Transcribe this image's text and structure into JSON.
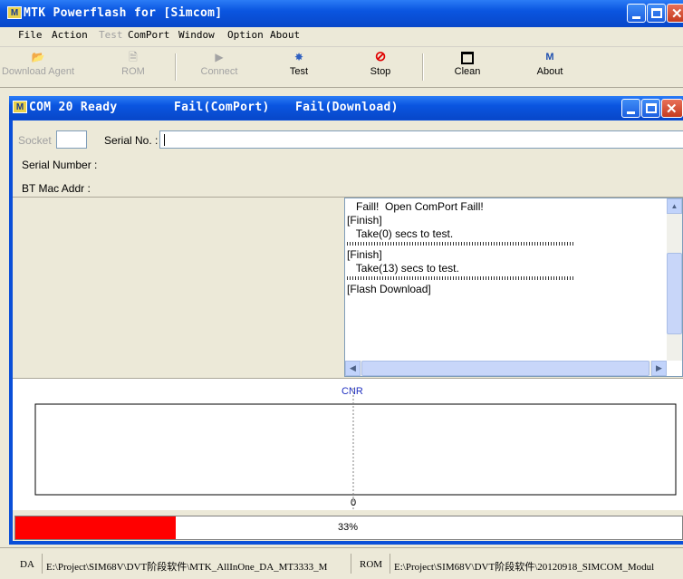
{
  "app": {
    "title": "MTK Powerflash for [Simcom]",
    "icon_letter": "M"
  },
  "menu": [
    {
      "label": "File",
      "enabled": true
    },
    {
      "label": "Action",
      "enabled": true
    },
    {
      "label": "Test",
      "enabled": false
    },
    {
      "label": "ComPort",
      "enabled": true
    },
    {
      "label": "Window",
      "enabled": true
    },
    {
      "label": "Option",
      "enabled": true
    },
    {
      "label": "About",
      "enabled": true
    }
  ],
  "toolbar": {
    "download_agent": "Download Agent",
    "rom": "ROM",
    "connect": "Connect",
    "test": "Test",
    "stop": "Stop",
    "clean": "Clean",
    "about": "About"
  },
  "child": {
    "com_status": "COM 20 Ready",
    "comport_status": "Fail(ComPort)",
    "download_status": "Fail(Download)"
  },
  "form": {
    "socket_label": "Socket",
    "socket_value": "",
    "serial_no_label": "Serial No. :",
    "serial_no_value": "",
    "serial_number_label": "Serial Number :",
    "bt_mac_label": "BT Mac Addr :"
  },
  "log": [
    "   Faill!  Open ComPort Faill!",
    "[Finish]",
    "   Take(0) secs to test.",
    "~~~",
    "[Finish]",
    "   Take(13) secs to test.",
    "~~~",
    "[Flash Download]"
  ],
  "chart_data": {
    "type": "line",
    "title": "CNR",
    "xlabel": "0",
    "series": []
  },
  "progress": {
    "percent": 33,
    "label": "33%",
    "color": "#ff0000"
  },
  "statusbar": {
    "da_label": "DA",
    "da_path": "E:\\Project\\SIM68V\\DVT阶段软件\\MTK_AllInOne_DA_MT3333_M",
    "rom_label": "ROM",
    "rom_path": "E:\\Project\\SIM68V\\DVT阶段软件\\20120918_SIMCOM_Modul"
  }
}
